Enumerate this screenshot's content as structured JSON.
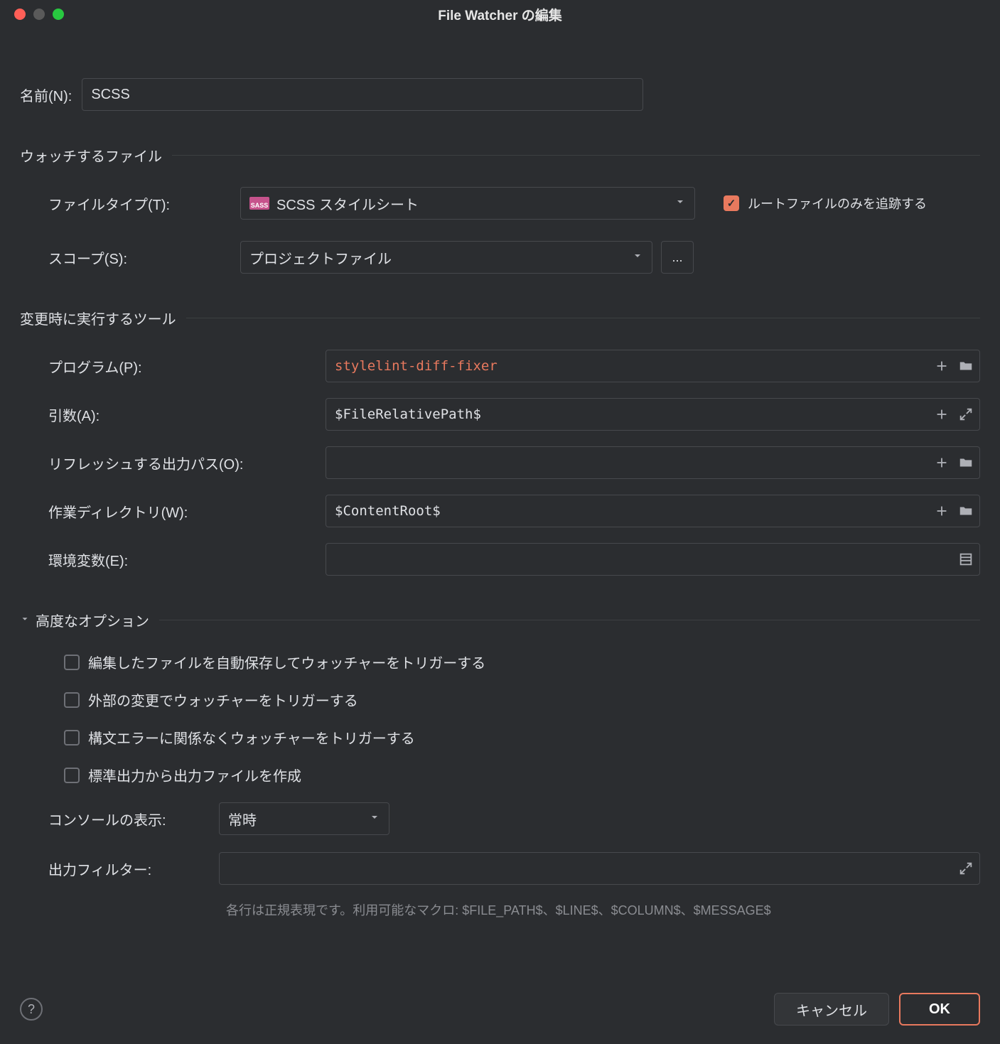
{
  "title": "File Watcher の編集",
  "name": {
    "label": "名前(N):",
    "value": "SCSS"
  },
  "watch_section": {
    "title": "ウォッチするファイル",
    "file_type": {
      "label": "ファイルタイプ(T):",
      "value": "SCSS スタイルシート"
    },
    "track_root": {
      "label": "ルートファイルのみを追跡する",
      "checked": true
    },
    "scope": {
      "label": "スコープ(S):",
      "value": "プロジェクトファイル",
      "more": "..."
    }
  },
  "tool_section": {
    "title": "変更時に実行するツール",
    "program": {
      "label": "プログラム(P):",
      "value": "stylelint-diff-fixer"
    },
    "arguments": {
      "label": "引数(A):",
      "value": "$FileRelativePath$"
    },
    "output_paths": {
      "label": "リフレッシュする出力パス(O):",
      "value": ""
    },
    "working_dir": {
      "label": "作業ディレクトリ(W):",
      "value": "$ContentRoot$"
    },
    "env": {
      "label": "環境変数(E):",
      "value": ""
    }
  },
  "advanced": {
    "title": "高度なオプション",
    "opt1": "編集したファイルを自動保存してウォッチャーをトリガーする",
    "opt2": "外部の変更でウォッチャーをトリガーする",
    "opt3": "構文エラーに関係なくウォッチャーをトリガーする",
    "opt4": "標準出力から出力ファイルを作成",
    "console": {
      "label": "コンソールの表示:",
      "value": "常時"
    },
    "filters": {
      "label": "出力フィルター:",
      "value": ""
    },
    "hint": "各行は正規表現です。利用可能なマクロ: $FILE_PATH$、$LINE$、$COLUMN$、$MESSAGE$"
  },
  "footer": {
    "cancel": "キャンセル",
    "ok": "OK"
  }
}
